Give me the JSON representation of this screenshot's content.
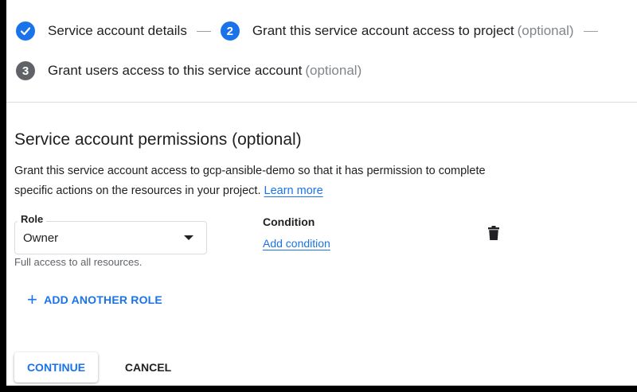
{
  "stepper": {
    "step1": {
      "label": "Service account details"
    },
    "step2": {
      "number": "2",
      "label": "Grant this service account access to project",
      "optional": "(optional)"
    },
    "step3": {
      "number": "3",
      "label": "Grant users access to this service account",
      "optional": "(optional)"
    }
  },
  "permissions": {
    "title": "Service account permissions (optional)",
    "description": "Grant this service account access to gcp-ansible-demo so that it has permission to complete specific actions on the resources in your project.",
    "learn_more": "Learn more"
  },
  "role": {
    "label": "Role",
    "value": "Owner",
    "help": "Full access to all resources."
  },
  "condition": {
    "label": "Condition",
    "add_link": "Add condition"
  },
  "actions": {
    "add_role": "ADD ANOTHER ROLE",
    "continue": "CONTINUE",
    "cancel": "CANCEL"
  },
  "icons": {
    "step_done": "check-icon",
    "delete": "trash-icon",
    "add": "plus-icon"
  },
  "colors": {
    "accent": "#1a73e8",
    "step_inactive": "#5f6368"
  }
}
